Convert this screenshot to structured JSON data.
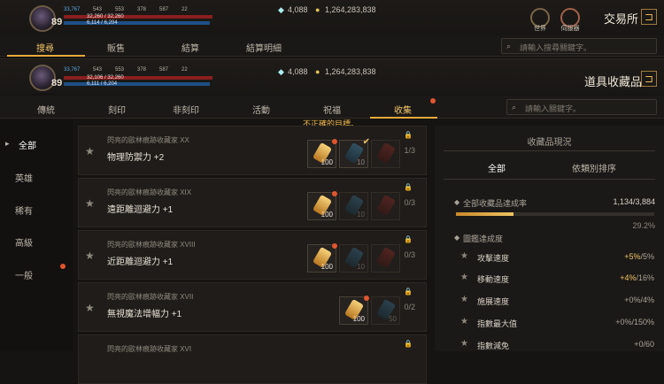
{
  "player": {
    "level": "89",
    "stats": [
      "33,767",
      "543",
      "553",
      "378",
      "587",
      "22"
    ],
    "hp_text": "32,260 / 32,260",
    "mp_text": "6,114 / 6,204"
  },
  "player2": {
    "level": "89",
    "stats": [
      "33,767",
      "543",
      "553",
      "378",
      "587",
      "22"
    ],
    "hp_text": "32,106 / 32,260",
    "mp_text": "6,111 / 6,204"
  },
  "currency": {
    "diamonds": "4,088",
    "gold": "1,264,283,838"
  },
  "top_icons": {
    "world": "世界",
    "server": "伺服器"
  },
  "exchange": {
    "title": "交易所",
    "tabs": [
      "搜尋",
      "販售",
      "結算",
      "結算明細"
    ],
    "search_placeholder": "請輸入搜尋關鍵字。"
  },
  "collection": {
    "title": "道具收藏品",
    "tabs": [
      "傳統",
      "刻印",
      "非刻印",
      "活動",
      "祝福",
      "收集"
    ],
    "search_placeholder": "請輸入關鍵字。",
    "warning": "不正確的目標。"
  },
  "sidebar": [
    "全部",
    "英雄",
    "稀有",
    "高級",
    "一般"
  ],
  "rows": [
    {
      "sub": "閃亮的歐林痕跡收藏家 XX",
      "name": "物理防禦力 +2",
      "count": "1/3",
      "slots": [
        "100",
        "10",
        ""
      ]
    },
    {
      "sub": "閃亮的歐林痕跡收藏家 XIX",
      "name": "遠距離迴避力 +1",
      "count": "0/3",
      "slots": [
        "100",
        "10",
        ""
      ]
    },
    {
      "sub": "閃亮的歐林痕跡收藏家 XVIII",
      "name": "近距離迴避力 +1",
      "count": "0/3",
      "slots": [
        "100",
        "10",
        ""
      ]
    },
    {
      "sub": "閃亮的歐林痕跡收藏家 XVII",
      "name": "無視魔法增幅力 +1",
      "count": "0/2",
      "slots": [
        "100",
        "50"
      ]
    },
    {
      "sub": "閃亮的歐林痕跡收藏家 XVI",
      "name": "",
      "count": "",
      "slots": []
    }
  ],
  "panel": {
    "title": "收藏品現況",
    "tabs": [
      "全部",
      "依類別排序"
    ],
    "total_label": "全部收藏品達成率",
    "total_value": "1,134/3,884",
    "percent": "29.2%",
    "progress": 0.292,
    "section": "圖鑑達成度",
    "stats": [
      {
        "name": "攻擊速度",
        "hl": "+5%",
        "rest": "/5%"
      },
      {
        "name": "移動速度",
        "hl": "+4%",
        "rest": "/16%"
      },
      {
        "name": "施展速度",
        "hl": "",
        "rest": "+0%/4%"
      },
      {
        "name": "指數最大值",
        "hl": "",
        "rest": "+0%/150%"
      },
      {
        "name": "指數減免",
        "hl": "",
        "rest": "+0/60"
      }
    ]
  }
}
